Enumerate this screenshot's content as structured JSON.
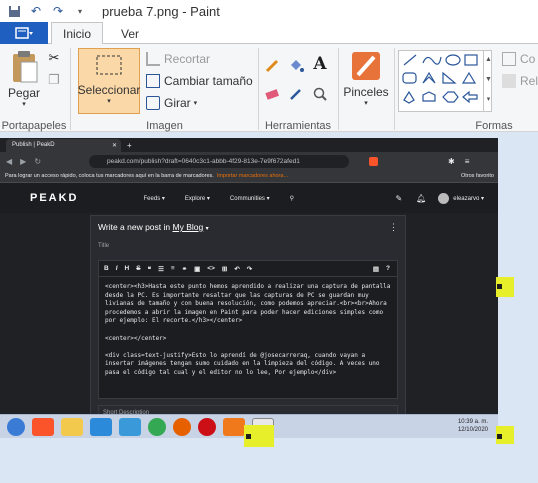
{
  "window_title": "prueba 7.png - Paint",
  "tabs": {
    "file_label": "",
    "inicio": "Inicio",
    "ver": "Ver"
  },
  "ribbon": {
    "pegar": "Pegar",
    "portapapeles": "Portapapeles",
    "seleccionar": "Seleccionar",
    "recortar": "Recortar",
    "cambiar_tamano": "Cambiar tamaño",
    "girar": "Girar",
    "imagen": "Imagen",
    "herramientas": "Herramientas",
    "pinceles": "Pinceles",
    "formas": "Formas",
    "contorno": "Co",
    "relleno": "Rel"
  },
  "browser": {
    "tab_title": "Publish | PeakD",
    "url": "peakd.com/publish?draft=0640c3c1-abbb-4f29-813e-7e9f672afed1",
    "bookmarks_text": "Para lograr un acceso rápido, coloca tus marcadores aquí en la barra de marcadores.",
    "bookmarks_link": "Importar marcadores ahora...",
    "other_favs": "Otros favorito"
  },
  "peakd": {
    "logo": "PEAKD",
    "nav": [
      "Feeds ▾",
      "Explore ▾",
      "Communities ▾"
    ],
    "user": "eleazarvo ▾",
    "heading_prefix": "Write a new post in",
    "heading_blog": "My Blog",
    "title_placeholder": "Title",
    "body": "<center><h3>Hasta este punto hemos aprendido a realizar una captura de pantalla desde la PC. Es importante resaltar que las capturas de PC se guardan muy livianas de tamaño y con buena resolución, como podemos apreciar.<br><br>Ahora procedemos a abrir la imagen en Paint para poder hacer ediciones simples como por ejemplo: El recorte.</h3></center>\n\n<center></center>\n\n<div class=text-justify>Esto lo aprendí de @josecarreraq, cuando vayan a insertar imágenes tengan sumo cuidado en la limpieza del código. A veces uno pasa el código tal cual y el editor no lo lee, Por ejemplo</div>",
    "short_description": "Short Description"
  },
  "taskbar": {
    "time": "10:39 a. m.",
    "date": "12/10/2020"
  },
  "colors": {
    "accent": "#1f5fbf",
    "selection": "#fbd8a8",
    "highlight": "#e6ef2a"
  }
}
